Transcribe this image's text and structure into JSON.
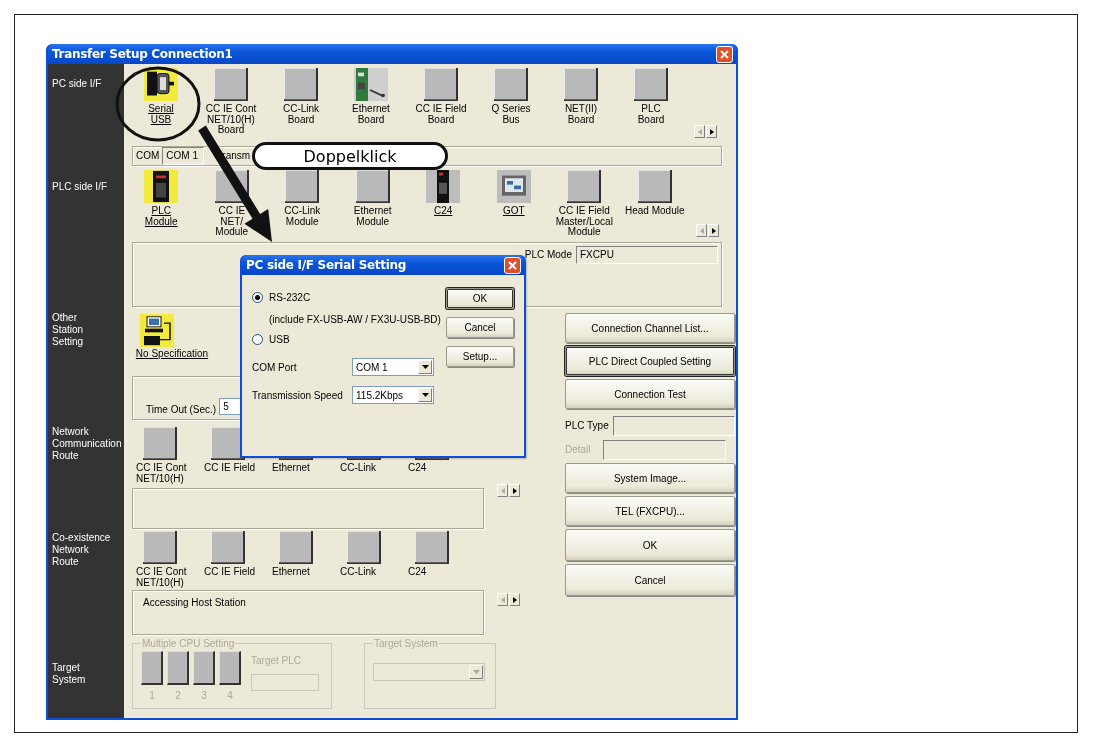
{
  "window": {
    "title": "Transfer Setup Connection1"
  },
  "pc_side_if": {
    "label": "PC side I/F",
    "items": [
      {
        "label": "Serial\nUSB",
        "kind": "serial",
        "selected": true
      },
      {
        "label": "CC IE Cont\nNET/10(H)\nBoard",
        "kind": "blank",
        "selected": false
      },
      {
        "label": "CC-Link\nBoard",
        "kind": "blank",
        "selected": false
      },
      {
        "label": "Ethernet\nBoard",
        "kind": "board",
        "selected": false
      },
      {
        "label": "CC IE Field\nBoard",
        "kind": "blank",
        "selected": false
      },
      {
        "label": "Q Series\nBus",
        "kind": "blank",
        "selected": false
      },
      {
        "label": "NET(II)\nBoard",
        "kind": "blank",
        "selected": false
      },
      {
        "label": "PLC\nBoard",
        "kind": "blank",
        "selected": false
      }
    ]
  },
  "com_line": {
    "label": "COM",
    "value": "COM 1",
    "text": "ransm"
  },
  "plc_side_if": {
    "label": "PLC side I/F",
    "items": [
      {
        "label": "PLC\nModule",
        "kind": "plc",
        "selected": true
      },
      {
        "label": "CC IE\nNET/\nModule",
        "kind": "blank",
        "selected": false
      },
      {
        "label": "CC-Link\nModule",
        "kind": "blank",
        "selected": false
      },
      {
        "label": "Ethernet\nModule",
        "kind": "blank",
        "selected": false
      },
      {
        "label": "C24",
        "kind": "module",
        "selected": true
      },
      {
        "label": "GOT",
        "kind": "got",
        "selected": true
      },
      {
        "label": "CC IE Field\nMaster/Local\nModule",
        "kind": "blank",
        "selected": false
      },
      {
        "label": "Head Module",
        "kind": "blank",
        "selected": false
      }
    ]
  },
  "plc_mode": {
    "label": "PLC Mode",
    "value": "FXCPU"
  },
  "other_station": {
    "label": "Other\nStation\nSetting",
    "item": {
      "label": "No Specification",
      "kind": "station",
      "selected": true
    }
  },
  "time_out": {
    "label": "Time Out (Sec.)",
    "value": "5"
  },
  "network_route": {
    "label": "Network\nCommunication\nRoute",
    "items": [
      {
        "label": "CC IE Cont\nNET/10(H)",
        "kind": "blank",
        "selected": false
      },
      {
        "label": "CC IE Field",
        "kind": "blank",
        "selected": false
      },
      {
        "label": "Ethernet",
        "kind": "blank",
        "selected": false
      },
      {
        "label": "CC-Link",
        "kind": "blank",
        "selected": false
      },
      {
        "label": "C24",
        "kind": "blank",
        "selected": false
      }
    ]
  },
  "coexistence_route": {
    "label": "Co-existence\nNetwork\nRoute",
    "items": [
      {
        "label": "CC IE Cont\nNET/10(H)",
        "kind": "blank",
        "selected": false
      },
      {
        "label": "CC IE Field",
        "kind": "blank",
        "selected": false
      },
      {
        "label": "Ethernet",
        "kind": "blank",
        "selected": false
      },
      {
        "label": "CC-Link",
        "kind": "blank",
        "selected": false
      },
      {
        "label": "C24",
        "kind": "blank",
        "selected": false
      }
    ],
    "status": "Accessing Host Station"
  },
  "target_system": {
    "label": "Target\nSystem",
    "disabled": true,
    "multiple_cpu": {
      "title": "Multiple CPU Setting",
      "slots": [
        "1",
        "2",
        "3",
        "4"
      ],
      "target_plc_label": "Target PLC"
    },
    "target_group": {
      "title": "Target System"
    }
  },
  "right_panel": {
    "top_buttons": [
      {
        "label": "Connection Channel List...",
        "default": false
      },
      {
        "label": "PLC Direct Coupled Setting",
        "default": true
      },
      {
        "label": "Connection Test",
        "default": false
      }
    ],
    "plc_type": {
      "label": "PLC Type"
    },
    "detail": {
      "label": "Detail",
      "disabled": true
    },
    "bottom_buttons": [
      {
        "label": "System Image...",
        "default": false
      },
      {
        "label": "TEL (FXCPU)...",
        "default": false
      },
      {
        "label": "OK",
        "default": false
      },
      {
        "label": "Cancel",
        "default": false
      }
    ]
  },
  "serial_dialog": {
    "title": "PC side I/F Serial Setting",
    "options": [
      {
        "label": "RS-232C",
        "selected": true,
        "note": "(include FX-USB-AW / FX3U-USB-BD)"
      },
      {
        "label": "USB",
        "selected": false
      }
    ],
    "com_port": {
      "label": "COM Port",
      "value": "COM 1"
    },
    "speed": {
      "label": "Transmission Speed",
      "value": "115.2Kbps"
    },
    "buttons": [
      {
        "label": "OK",
        "default": true
      },
      {
        "label": "Cancel",
        "default": false
      },
      {
        "label": "Setup...",
        "default": false
      }
    ]
  },
  "annotation": {
    "callout": "Doppelklick"
  }
}
